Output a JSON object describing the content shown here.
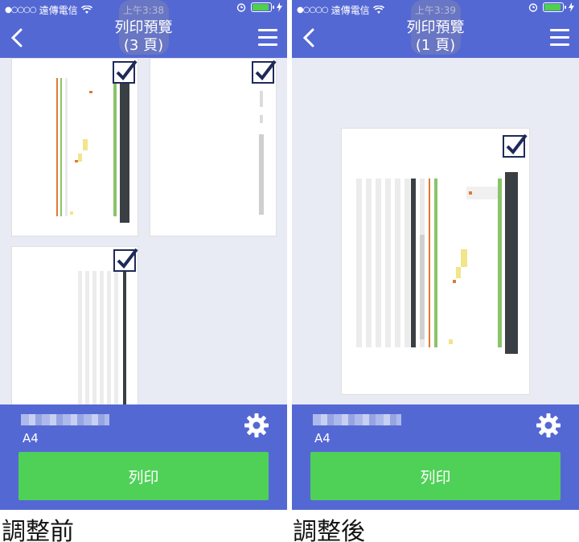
{
  "left_screen": {
    "status": {
      "carrier": "遠傳電信",
      "time": "上午3:38"
    },
    "nav": {
      "title_line1": "列印預覽",
      "title_line2": "(3 頁)"
    },
    "paper_size": "A4",
    "print_label": "列印",
    "caption": "調整前"
  },
  "right_screen": {
    "status": {
      "carrier": "遠傳電信",
      "time": "上午3:39"
    },
    "nav": {
      "title_line1": "列印預覽",
      "title_line2": "(1 頁)"
    },
    "paper_size": "A4",
    "print_label": "列印",
    "caption": "調整後"
  },
  "colors": {
    "bar": "#5468d4",
    "print_button": "#4fd157",
    "background": "#e8eaf4",
    "battery": "#4fd04f"
  },
  "icons": [
    "wifi-icon",
    "alarm-icon",
    "battery-icon",
    "charging-icon",
    "back-icon",
    "menu-icon",
    "gear-icon",
    "checkbox-checked-icon"
  ]
}
